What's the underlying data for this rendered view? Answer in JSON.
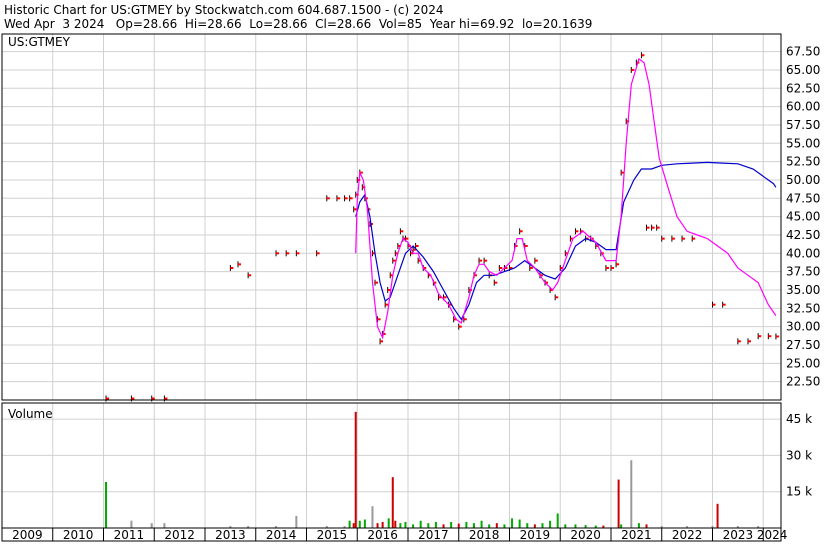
{
  "header": {
    "line1": "Historic Chart for US:GTMEY by Stockwatch.com 604.687.1500 - (c) 2024",
    "line2": "Wed Apr  3 2024   Op=28.66  Hi=28.66  Lo=28.66  Cl=28.66  Vol=85  Year hi=69.92  lo=20.1639"
  },
  "colors": {
    "price_bar": "#000000",
    "price_close": "#ff0000",
    "ma_short": "#ff00ff",
    "ma_long": "#0000cc",
    "vol_up": "#00aa00",
    "vol_down": "#cc0000",
    "vol_neutral": "#999999",
    "grid": "#d0d0d0"
  },
  "chart_data": [
    {
      "type": "line",
      "symbol_label": "US:GTMEY",
      "x_range": [
        2009.0,
        2024.35
      ],
      "ylim": [
        20.0,
        69.9
      ],
      "y_ticks": [
        "67.50",
        "65.00",
        "62.50",
        "60.00",
        "57.50",
        "55.00",
        "52.50",
        "50.00",
        "47.50",
        "45.00",
        "42.50",
        "40.00",
        "37.50",
        "35.00",
        "32.50",
        "30.00",
        "27.50",
        "25.00",
        "22.50"
      ],
      "x_ticks": [
        "2009",
        "2010",
        "2011",
        "2012",
        "2013",
        "2014",
        "2015",
        "2016",
        "2017",
        "2018",
        "2019",
        "2020",
        "2021",
        "2022",
        "2023",
        "2024"
      ],
      "grid": true,
      "closes": [
        [
          2011.05,
          20.2
        ],
        [
          2011.55,
          20.2
        ],
        [
          2011.95,
          20.2
        ],
        [
          2012.2,
          20.2
        ],
        [
          2013.5,
          38
        ],
        [
          2013.65,
          38.5
        ],
        [
          2013.85,
          37
        ],
        [
          2014.4,
          40
        ],
        [
          2014.6,
          40
        ],
        [
          2014.8,
          40
        ],
        [
          2015.2,
          40
        ],
        [
          2015.4,
          47.5
        ],
        [
          2015.6,
          47.5
        ],
        [
          2015.75,
          47.5
        ],
        [
          2015.85,
          47.5
        ],
        [
          2015.93,
          46
        ],
        [
          2015.97,
          48
        ],
        [
          2016.0,
          50
        ],
        [
          2016.05,
          51
        ],
        [
          2016.1,
          49
        ],
        [
          2016.15,
          47.5
        ],
        [
          2016.2,
          46
        ],
        [
          2016.25,
          44
        ],
        [
          2016.3,
          40
        ],
        [
          2016.35,
          36
        ],
        [
          2016.4,
          31
        ],
        [
          2016.45,
          28
        ],
        [
          2016.5,
          29
        ],
        [
          2016.55,
          33
        ],
        [
          2016.6,
          35
        ],
        [
          2016.65,
          37
        ],
        [
          2016.7,
          39
        ],
        [
          2016.75,
          40
        ],
        [
          2016.8,
          41
        ],
        [
          2016.85,
          43
        ],
        [
          2016.9,
          42
        ],
        [
          2016.95,
          42
        ],
        [
          2017.0,
          41
        ],
        [
          2017.05,
          40
        ],
        [
          2017.1,
          40.5
        ],
        [
          2017.15,
          41
        ],
        [
          2017.2,
          39
        ],
        [
          2017.3,
          38
        ],
        [
          2017.4,
          37
        ],
        [
          2017.5,
          36
        ],
        [
          2017.6,
          34
        ],
        [
          2017.7,
          34
        ],
        [
          2017.8,
          33
        ],
        [
          2017.9,
          31
        ],
        [
          2018.0,
          30
        ],
        [
          2018.1,
          31
        ],
        [
          2018.2,
          35
        ],
        [
          2018.3,
          37
        ],
        [
          2018.4,
          39
        ],
        [
          2018.5,
          39
        ],
        [
          2018.6,
          37
        ],
        [
          2018.7,
          36
        ],
        [
          2018.8,
          38
        ],
        [
          2018.9,
          38
        ],
        [
          2019.0,
          38
        ],
        [
          2019.1,
          41
        ],
        [
          2019.2,
          43
        ],
        [
          2019.3,
          41
        ],
        [
          2019.4,
          38
        ],
        [
          2019.5,
          39
        ],
        [
          2019.6,
          37
        ],
        [
          2019.7,
          36
        ],
        [
          2019.8,
          35
        ],
        [
          2019.9,
          34
        ],
        [
          2020.0,
          38
        ],
        [
          2020.1,
          40
        ],
        [
          2020.2,
          42
        ],
        [
          2020.3,
          43
        ],
        [
          2020.4,
          43
        ],
        [
          2020.5,
          42
        ],
        [
          2020.6,
          42
        ],
        [
          2020.7,
          41
        ],
        [
          2020.8,
          40
        ],
        [
          2020.9,
          38
        ],
        [
          2021.0,
          38
        ],
        [
          2021.1,
          38.5
        ],
        [
          2021.2,
          51
        ],
        [
          2021.3,
          58
        ],
        [
          2021.4,
          65
        ],
        [
          2021.5,
          66
        ],
        [
          2021.6,
          67
        ],
        [
          2021.7,
          43.5
        ],
        [
          2021.8,
          43.5
        ],
        [
          2021.9,
          43.5
        ],
        [
          2022.0,
          42
        ],
        [
          2022.2,
          42
        ],
        [
          2022.4,
          42
        ],
        [
          2022.6,
          42
        ],
        [
          2023.0,
          33
        ],
        [
          2023.2,
          33
        ],
        [
          2023.5,
          28
        ],
        [
          2023.7,
          28
        ],
        [
          2023.9,
          28.7
        ],
        [
          2024.1,
          28.7
        ],
        [
          2024.25,
          28.66
        ]
      ],
      "ma_short": [
        [
          2015.97,
          40
        ],
        [
          2016.0,
          47
        ],
        [
          2016.05,
          51
        ],
        [
          2016.12,
          50
        ],
        [
          2016.2,
          46
        ],
        [
          2016.3,
          36
        ],
        [
          2016.4,
          30
        ],
        [
          2016.5,
          28.5
        ],
        [
          2016.6,
          32
        ],
        [
          2016.7,
          37
        ],
        [
          2016.8,
          40
        ],
        [
          2016.9,
          42
        ],
        [
          2017.0,
          41.5
        ],
        [
          2017.1,
          40
        ],
        [
          2017.2,
          40
        ],
        [
          2017.3,
          38
        ],
        [
          2017.45,
          37
        ],
        [
          2017.6,
          34.5
        ],
        [
          2017.8,
          33
        ],
        [
          2017.95,
          31
        ],
        [
          2018.05,
          30.5
        ],
        [
          2018.2,
          34
        ],
        [
          2018.3,
          37
        ],
        [
          2018.4,
          38.5
        ],
        [
          2018.5,
          38.5
        ],
        [
          2018.6,
          37.5
        ],
        [
          2018.75,
          37
        ],
        [
          2018.9,
          38
        ],
        [
          2019.05,
          39
        ],
        [
          2019.15,
          42
        ],
        [
          2019.25,
          42
        ],
        [
          2019.35,
          39
        ],
        [
          2019.5,
          38
        ],
        [
          2019.7,
          36
        ],
        [
          2019.85,
          35
        ],
        [
          2019.95,
          36
        ],
        [
          2020.1,
          39
        ],
        [
          2020.25,
          42
        ],
        [
          2020.45,
          43
        ],
        [
          2020.7,
          41.5
        ],
        [
          2020.9,
          39
        ],
        [
          2021.1,
          39
        ],
        [
          2021.2,
          45
        ],
        [
          2021.3,
          55
        ],
        [
          2021.4,
          63
        ],
        [
          2021.55,
          66.5
        ],
        [
          2021.65,
          66
        ],
        [
          2021.75,
          63
        ],
        [
          2021.85,
          58
        ],
        [
          2021.95,
          53
        ],
        [
          2022.1,
          49.5
        ],
        [
          2022.3,
          45
        ],
        [
          2022.5,
          43
        ],
        [
          2022.7,
          42.5
        ],
        [
          2022.9,
          42
        ],
        [
          2023.1,
          41
        ],
        [
          2023.3,
          40
        ],
        [
          2023.5,
          38
        ],
        [
          2023.7,
          37
        ],
        [
          2023.9,
          36
        ],
        [
          2024.0,
          34.5
        ],
        [
          2024.1,
          33
        ],
        [
          2024.2,
          32
        ],
        [
          2024.25,
          31.5
        ]
      ],
      "ma_long": [
        [
          2015.97,
          45
        ],
        [
          2016.05,
          47
        ],
        [
          2016.15,
          48
        ],
        [
          2016.25,
          45
        ],
        [
          2016.35,
          40
        ],
        [
          2016.45,
          36
        ],
        [
          2016.55,
          33.5
        ],
        [
          2016.65,
          34
        ],
        [
          2016.8,
          37
        ],
        [
          2016.95,
          40
        ],
        [
          2017.1,
          41
        ],
        [
          2017.3,
          39.5
        ],
        [
          2017.5,
          37.5
        ],
        [
          2017.7,
          35
        ],
        [
          2017.9,
          32.5
        ],
        [
          2018.05,
          31
        ],
        [
          2018.2,
          33
        ],
        [
          2018.35,
          36
        ],
        [
          2018.5,
          37
        ],
        [
          2018.7,
          37
        ],
        [
          2018.9,
          37.5
        ],
        [
          2019.1,
          38
        ],
        [
          2019.3,
          39
        ],
        [
          2019.5,
          38
        ],
        [
          2019.7,
          37
        ],
        [
          2019.9,
          36.5
        ],
        [
          2020.1,
          38
        ],
        [
          2020.3,
          41
        ],
        [
          2020.5,
          42
        ],
        [
          2020.7,
          41.5
        ],
        [
          2020.9,
          40.5
        ],
        [
          2021.1,
          40.5
        ],
        [
          2021.25,
          47
        ],
        [
          2021.45,
          50
        ],
        [
          2021.6,
          51.5
        ],
        [
          2021.8,
          51.5
        ],
        [
          2022.0,
          52
        ],
        [
          2022.3,
          52.2
        ],
        [
          2022.6,
          52.3
        ],
        [
          2022.9,
          52.4
        ],
        [
          2023.2,
          52.3
        ],
        [
          2023.5,
          52.2
        ],
        [
          2023.8,
          51.5
        ],
        [
          2024.0,
          50.5
        ],
        [
          2024.2,
          49.5
        ],
        [
          2024.25,
          49
        ]
      ]
    },
    {
      "type": "bar",
      "title": "Volume",
      "ylim": [
        0,
        50000
      ],
      "y_ticks": [
        "45 k",
        "30 k",
        "15 k"
      ],
      "bars": [
        [
          2011.05,
          19000,
          "up"
        ],
        [
          2011.55,
          3000,
          "neutral"
        ],
        [
          2011.95,
          2000,
          "neutral"
        ],
        [
          2012.2,
          2000,
          "neutral"
        ],
        [
          2013.5,
          800,
          "neutral"
        ],
        [
          2013.85,
          800,
          "neutral"
        ],
        [
          2014.4,
          800,
          "neutral"
        ],
        [
          2014.8,
          5000,
          "neutral"
        ],
        [
          2015.4,
          800,
          "neutral"
        ],
        [
          2015.75,
          800,
          "neutral"
        ],
        [
          2015.85,
          3000,
          "up"
        ],
        [
          2015.93,
          2000,
          "down"
        ],
        [
          2015.97,
          48000,
          "down"
        ],
        [
          2016.05,
          3000,
          "up"
        ],
        [
          2016.15,
          3500,
          "up"
        ],
        [
          2016.3,
          9000,
          "neutral"
        ],
        [
          2016.4,
          2000,
          "down"
        ],
        [
          2016.5,
          2500,
          "down"
        ],
        [
          2016.62,
          4000,
          "up"
        ],
        [
          2016.7,
          21000,
          "down"
        ],
        [
          2016.75,
          3000,
          "down"
        ],
        [
          2016.85,
          2000,
          "up"
        ],
        [
          2016.95,
          2500,
          "up"
        ],
        [
          2017.1,
          1500,
          "up"
        ],
        [
          2017.25,
          3000,
          "up"
        ],
        [
          2017.4,
          2000,
          "up"
        ],
        [
          2017.55,
          2500,
          "up"
        ],
        [
          2017.7,
          1500,
          "down"
        ],
        [
          2017.85,
          2500,
          "up"
        ],
        [
          2018.0,
          1800,
          "down"
        ],
        [
          2018.15,
          2500,
          "up"
        ],
        [
          2018.3,
          2000,
          "up"
        ],
        [
          2018.45,
          3000,
          "up"
        ],
        [
          2018.6,
          1500,
          "up"
        ],
        [
          2018.75,
          2000,
          "down"
        ],
        [
          2018.9,
          1500,
          "up"
        ],
        [
          2019.05,
          4000,
          "up"
        ],
        [
          2019.2,
          3500,
          "up"
        ],
        [
          2019.35,
          2000,
          "up"
        ],
        [
          2019.5,
          1500,
          "down"
        ],
        [
          2019.65,
          2000,
          "up"
        ],
        [
          2019.8,
          3000,
          "up"
        ],
        [
          2019.95,
          6000,
          "up"
        ],
        [
          2020.1,
          1500,
          "up"
        ],
        [
          2020.3,
          1500,
          "up"
        ],
        [
          2020.5,
          1200,
          "up"
        ],
        [
          2020.7,
          1000,
          "up"
        ],
        [
          2020.85,
          1000,
          "down"
        ],
        [
          2021.15,
          20000,
          "down"
        ],
        [
          2021.2,
          1500,
          "up"
        ],
        [
          2021.4,
          28000,
          "neutral"
        ],
        [
          2021.55,
          2000,
          "up"
        ],
        [
          2021.7,
          1500,
          "down"
        ],
        [
          2022.0,
          800,
          "neutral"
        ],
        [
          2022.5,
          800,
          "neutral"
        ],
        [
          2023.0,
          800,
          "neutral"
        ],
        [
          2023.1,
          10000,
          "down"
        ],
        [
          2023.5,
          800,
          "neutral"
        ],
        [
          2023.9,
          800,
          "neutral"
        ]
      ]
    }
  ]
}
